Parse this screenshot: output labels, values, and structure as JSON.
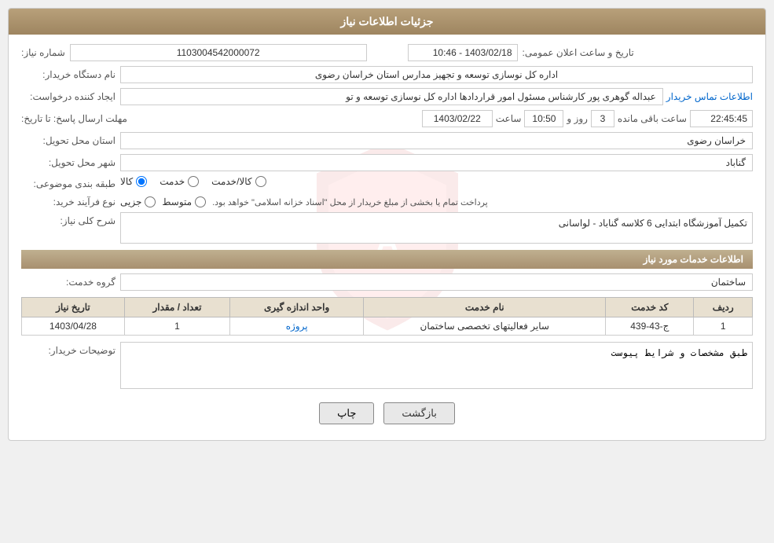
{
  "page": {
    "title": "جزئیات اطلاعات نیاز"
  },
  "header": {
    "announcement_label": "تاریخ و ساعت اعلان عمومی:",
    "announcement_value": "1403/02/18 - 10:46",
    "need_number_label": "شماره نیاز:",
    "need_number_value": "1103004542000072",
    "buyer_org_label": "نام دستگاه خریدار:",
    "buyer_org_value": "اداره کل نوسازی  توسعه و تجهیز مدارس استان خراسان رضوی",
    "creator_label": "ایجاد کننده درخواست:",
    "creator_value": "عبداله گوهری پور کارشناس مسئول امور قراردادها  اداره کل نوسازی  توسعه و تو",
    "creator_link": "اطلاعات تماس خریدار",
    "deadline_label": "مهلت ارسال پاسخ: تا تاریخ:",
    "deadline_date": "1403/02/22",
    "deadline_time_label": "ساعت",
    "deadline_time": "10:50",
    "deadline_day_label": "روز و",
    "deadline_days": "3",
    "deadline_remaining_label": "ساعت باقی مانده",
    "deadline_remaining": "22:45:45",
    "province_label": "استان محل تحویل:",
    "province_value": "خراسان رضوی",
    "city_label": "شهر محل تحویل:",
    "city_value": "گناباد",
    "category_label": "طبقه بندی موضوعی:",
    "category_options": [
      "کالا",
      "خدمت",
      "کالا/خدمت"
    ],
    "category_selected": "کالا",
    "purchase_type_label": "نوع فرآیند خرید:",
    "purchase_types": [
      "جزیی",
      "متوسط"
    ],
    "purchase_note": "پرداخت تمام یا بخشی از مبلغ خریدار از محل \"اسناد خزانه اسلامی\" خواهد بود.",
    "general_desc_label": "شرح کلی نیاز:",
    "general_desc_value": "تکمیل آموزشگاه ابتدایی 6 کلاسه گناباد - لواسانی"
  },
  "services_section": {
    "title": "اطلاعات خدمات مورد نیاز",
    "service_group_label": "گروه خدمت:",
    "service_group_value": "ساختمان",
    "table": {
      "columns": [
        "ردیف",
        "کد خدمت",
        "نام خدمت",
        "واحد اندازه گیری",
        "تعداد / مقدار",
        "تاریخ نیاز"
      ],
      "rows": [
        {
          "row": "1",
          "code": "ج-43-439",
          "name": "سایر فعالیتهای تخصصی ساختمان",
          "unit": "پروژه",
          "quantity": "1",
          "date": "1403/04/28"
        }
      ]
    }
  },
  "buyer_desc_label": "توضیحات خریدار:",
  "buyer_desc_value": "طبق مشخصات و شرایط پیوست",
  "buttons": {
    "print": "چاپ",
    "back": "بازگشت"
  }
}
